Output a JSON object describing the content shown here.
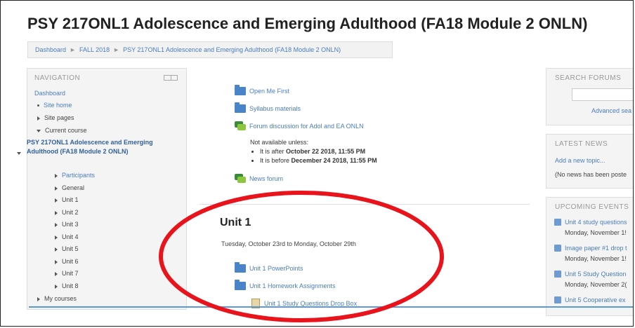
{
  "page": {
    "title": "PSY 217ONL1 Adolescence and Emerging Adulthood (FA18 Module 2 ONLN)"
  },
  "breadcrumb": {
    "items": [
      "Dashboard",
      "FALL 2018",
      "PSY 217ONL1 Adolescence and Emerging Adulthood (FA18 Module 2 ONLN)"
    ],
    "separator": "►"
  },
  "navigation": {
    "header": "NAVIGATION",
    "dashboard": "Dashboard",
    "site_home": "Site home",
    "site_pages": "Site pages",
    "current_course": "Current course",
    "course_name": "PSY 217ONL1 Adolescence and Emerging Adulthood (FA18 Module 2 ONLN)",
    "course_children": [
      "Participants",
      "General",
      "Unit 1",
      "Unit 2",
      "Unit 3",
      "Unit 4",
      "Unit 5",
      "Unit 6",
      "Unit 7",
      "Unit 8"
    ],
    "my_courses": "My courses"
  },
  "content": {
    "activities": [
      {
        "label": "Open Me First",
        "icon": "folder-icon"
      },
      {
        "label": "Syllabus materials",
        "icon": "folder-icon"
      },
      {
        "label": "Forum discussion for Adol and EA ONLN",
        "icon": "forum-icon"
      }
    ],
    "restriction": {
      "heading": "Not available unless:",
      "after_prefix": "It is after ",
      "after_date": "October 22 2018, 11:55 PM",
      "before_prefix": "It is before ",
      "before_date": "December 24 2018, 11:55 PM"
    },
    "news_forum": "News forum",
    "unit": {
      "title": "Unit 1",
      "dates": "Tuesday, October 23rd to Monday, October 29th",
      "items": [
        {
          "label": "Unit 1 PowerPoints",
          "icon": "folder-icon"
        },
        {
          "label": "Unit 1 Homework Assignments",
          "icon": "folder-icon"
        },
        {
          "label": "Unit 1 Study Questions Drop Box",
          "icon": "file-icon"
        }
      ]
    }
  },
  "search_forums": {
    "title": "SEARCH FORUMS",
    "advanced": "Advanced sea"
  },
  "latest_news": {
    "title": "LATEST NEWS",
    "add_topic": "Add a new topic...",
    "empty": "(No news has been poste"
  },
  "upcoming_events": {
    "title": "UPCOMING EVENTS",
    "events": [
      {
        "name": "Unit 4 study questions",
        "date": "Monday, November 1!"
      },
      {
        "name": "Image paper #1 drop t",
        "date": "Monday, November 1!"
      },
      {
        "name": "Unit 5 Study Question",
        "date": "Monday, November 2("
      },
      {
        "name": "Unit 5 Cooperative ex",
        "date": ""
      }
    ]
  },
  "annotation": {
    "color": "#e8131b"
  }
}
